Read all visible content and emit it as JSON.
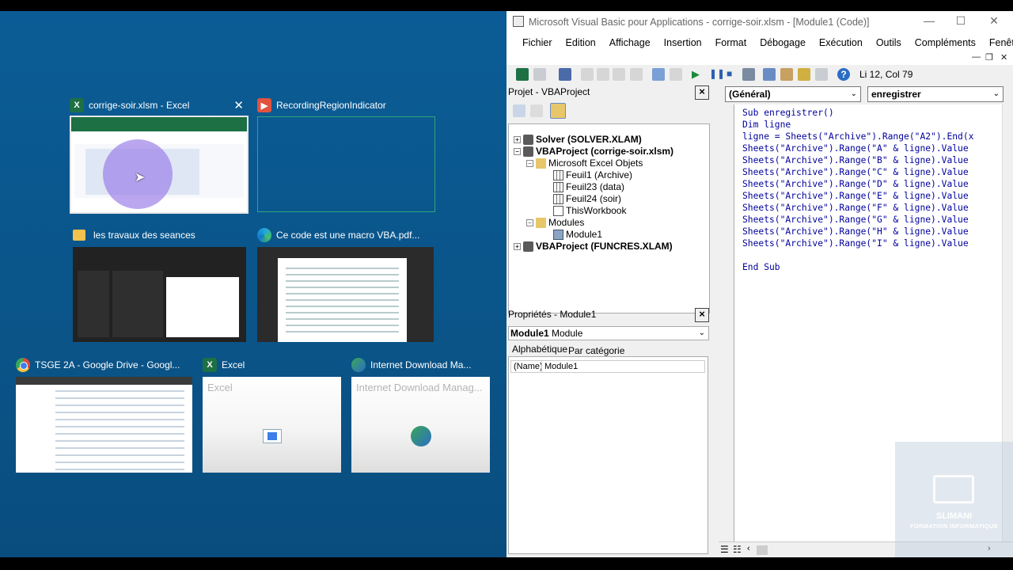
{
  "switcher": {
    "windows": [
      {
        "title": "corrige-soir.xlsm - Excel"
      },
      {
        "title": "RecordingRegionIndicator"
      },
      {
        "title": "les travaux des seances"
      },
      {
        "title": "Ce code est une macro VBA.pdf..."
      },
      {
        "title": "TSGE 2A - Google Drive - Googl..."
      },
      {
        "title": "Excel",
        "preview_text": "Excel"
      },
      {
        "title": "Internet Download Ma...",
        "preview_text": "Internet Download Manag..."
      }
    ],
    "close_glyph": "✕"
  },
  "vbe": {
    "title": "Microsoft Visual Basic pour Applications - corrige-soir.xlsm - [Module1 (Code)]",
    "window_buttons": {
      "minimize": "—",
      "maximize": "☐",
      "close": "✕"
    },
    "menu": [
      "Fichier",
      "Edition",
      "Affichage",
      "Insertion",
      "Format",
      "Débogage",
      "Exécution",
      "Outils",
      "Compléments",
      "Fenêtre",
      "?"
    ],
    "mdi_buttons": {
      "minimize": "—",
      "restore": "❐",
      "close": "✕"
    },
    "toolbar_position": "Li 12, Col 79",
    "project": {
      "title": "Projet - VBAProject",
      "tree": [
        {
          "label": "Solver (SOLVER.XLAM)",
          "bold": true,
          "expander": "+"
        },
        {
          "label": "VBAProject (corrige-soir.xlsm)",
          "bold": true,
          "expander": "−"
        },
        {
          "label": "Microsoft Excel Objets",
          "expander": "−"
        },
        {
          "label": "Feuil1 (Archive)"
        },
        {
          "label": "Feuil23 (data)"
        },
        {
          "label": "Feuil24 (soir)"
        },
        {
          "label": "ThisWorkbook"
        },
        {
          "label": "Modules",
          "expander": "−"
        },
        {
          "label": "Module1"
        },
        {
          "label": "VBAProject (FUNCRES.XLAM)",
          "bold": true,
          "expander": "+"
        }
      ]
    },
    "properties": {
      "title": "Propriétés - Module1",
      "object_name": "Module1",
      "object_type": "Module",
      "tab_alpha": "Alphabétique",
      "tab_category": "Par catégorie",
      "prop_name": "(Name)",
      "prop_value": "Module1"
    },
    "code": {
      "object_combo": "(Général)",
      "proc_combo": "enregistrer",
      "lines": [
        "Sub enregistrer()",
        "Dim ligne",
        "ligne = Sheets(\"Archive\").Range(\"A2\").End(x",
        "Sheets(\"Archive\").Range(\"A\" & ligne).Value",
        "Sheets(\"Archive\").Range(\"B\" & ligne).Value",
        "Sheets(\"Archive\").Range(\"C\" & ligne).Value",
        "Sheets(\"Archive\").Range(\"D\" & ligne).Value",
        "Sheets(\"Archive\").Range(\"E\" & ligne).Value",
        "Sheets(\"Archive\").Range(\"F\" & ligne).Value",
        "Sheets(\"Archive\").Range(\"G\" & ligne).Value",
        "Sheets(\"Archive\").Range(\"H\" & ligne).Value",
        "Sheets(\"Archive\").Range(\"I\" & ligne).Value",
        "",
        "End Sub"
      ],
      "code_color": "#00009c"
    }
  },
  "watermark": {
    "name": "SLIMANI",
    "subtitle": "FORMATION INFORMATIQUE"
  },
  "colors": {
    "desktop": "#0b5c96",
    "excel": "#1d7044",
    "vbe_chrome": "#f0f0f0"
  }
}
